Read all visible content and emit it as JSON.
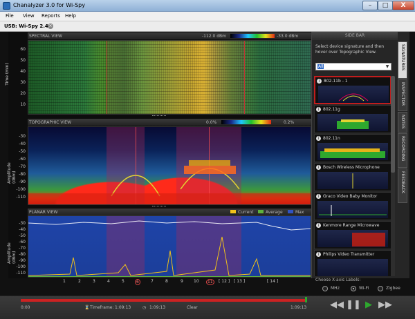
{
  "window": {
    "title": "Chanalyzer 3.0 for Wi-Spy",
    "buttons": {
      "minimize": "–",
      "maximize": "□",
      "close": "X"
    }
  },
  "menu": [
    "File",
    "View",
    "Reports",
    "Help"
  ],
  "device": {
    "label": "USB: Wi-Spy 2.4x"
  },
  "spectral": {
    "title": "SPECTRAL VIEW",
    "scale_min": "-112.0 dBm",
    "scale_max": "-33.0 dBm",
    "ylabel": "Time (min)",
    "yticks": [
      "60",
      "50",
      "40",
      "30",
      "20",
      "10"
    ]
  },
  "topographic": {
    "title": "TOPOGRAPHIC VIEW",
    "scale_min": "0.0%",
    "scale_max": "0.2%",
    "ylabel": "Amplitude (dBm)",
    "yticks": [
      "-30",
      "-40",
      "-50",
      "-60",
      "-70",
      "-80",
      "-90",
      "-100",
      "-110"
    ]
  },
  "planar": {
    "title": "PLANAR VIEW",
    "legend": [
      "Current",
      "Average",
      "Max"
    ],
    "legend_colors": [
      "#f2c21a",
      "#5db23c",
      "#3153c2"
    ],
    "ylabel": "Amplitude (dBm)",
    "yticks": [
      "-30",
      "-40",
      "-50",
      "-60",
      "-70",
      "-80",
      "-90",
      "-100",
      "-110"
    ]
  },
  "xticks": [
    "1",
    "2",
    "3",
    "4",
    "5",
    "6",
    "7",
    "8",
    "9",
    "10",
    "11",
    "[ 12 ]",
    "[ 13 ]",
    "[ 14 ]"
  ],
  "sidebar": {
    "title": "SIDE BAR",
    "instructions": "Select device signature and then hover over Topographic View.",
    "filter_value": "All",
    "signatures": [
      "802.11b - 1",
      "802.11g",
      "802.11n",
      "Bosch Wireless Microphone",
      "Graco Video Baby Monitor",
      "Kenmore Range Microwave",
      "Philips Video Transmitter"
    ],
    "tabs": [
      "SIGNATURES",
      "INSPECTOR",
      "NOTES",
      "RECORDING",
      "FEEDBACK"
    ]
  },
  "xaxis_chooser": {
    "label": "Choose X-axis Labels:",
    "options": [
      "MHz",
      "Wi-Fi",
      "Zigbee"
    ],
    "selected": "Wi-Fi"
  },
  "status": {
    "start": "0:00",
    "end": "1:09:13",
    "timeframe_label": "Timeframe:",
    "timeframe": "1:09:13",
    "current": "1:09:13",
    "clear": "Clear",
    "right_time": "1:09:13"
  }
}
